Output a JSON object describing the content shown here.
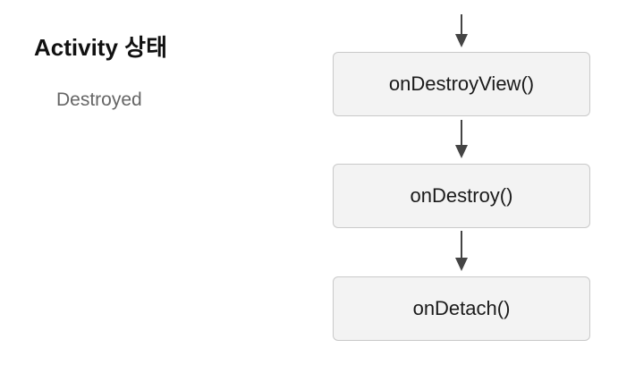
{
  "state_panel": {
    "title": "Activity 상태",
    "value": "Destroyed"
  },
  "flow": {
    "nodes": [
      {
        "label": "onDestroyView()"
      },
      {
        "label": "onDestroy()"
      },
      {
        "label": "onDetach()"
      }
    ],
    "colors": {
      "arrow": "#444444",
      "box_fill": "#f3f3f3",
      "box_border": "#c9c9c9"
    }
  }
}
